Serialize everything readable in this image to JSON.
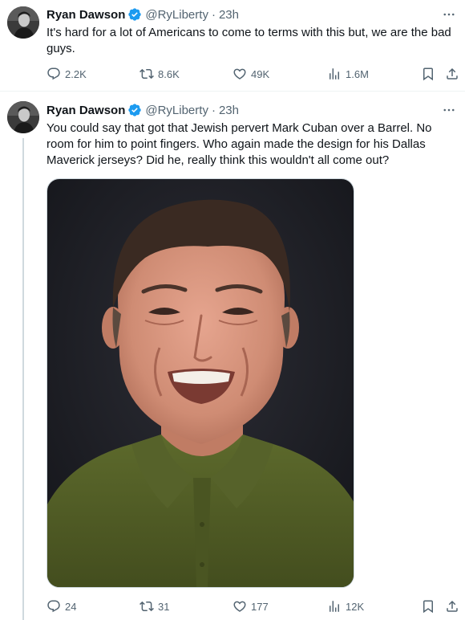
{
  "tweets": [
    {
      "author": {
        "name": "Ryan Dawson",
        "handle": "@RyLiberty",
        "verified": true
      },
      "time": "23h",
      "separator": "·",
      "text": "It's hard for a lot of Americans to come to terms with this but, we are the bad guys.",
      "stats": {
        "replies": "2.2K",
        "retweets": "8.6K",
        "likes": "49K",
        "views": "1.6M"
      }
    },
    {
      "author": {
        "name": "Ryan Dawson",
        "handle": "@RyLiberty",
        "verified": true
      },
      "time": "23h",
      "separator": "·",
      "text": "You could say that got that Jewish pervert Mark Cuban over a Barrel. No room for him to point fingers. Who again made the design for his Dallas Maverick jerseys? Did he, really think this wouldn't all come out?",
      "media": {
        "type": "photo",
        "subject": "smiling man in olive-green collared shirt against dark backdrop"
      },
      "stats": {
        "replies": "24",
        "retweets": "31",
        "likes": "177",
        "views": "12K"
      }
    }
  ],
  "colors": {
    "text_primary": "#0f1419",
    "text_secondary": "#536471",
    "verified_badge": "#1d9bf0",
    "divider": "#eff3f4",
    "thread_line": "#cfd9de"
  },
  "icons": {
    "reply": "speech-bubble-icon",
    "retweet": "retweet-arrows-icon",
    "like": "heart-icon",
    "views": "bar-chart-icon",
    "bookmark": "bookmark-icon",
    "share": "share-upload-icon",
    "more": "three-dots-icon",
    "verified": "verified-check-badge-icon"
  }
}
